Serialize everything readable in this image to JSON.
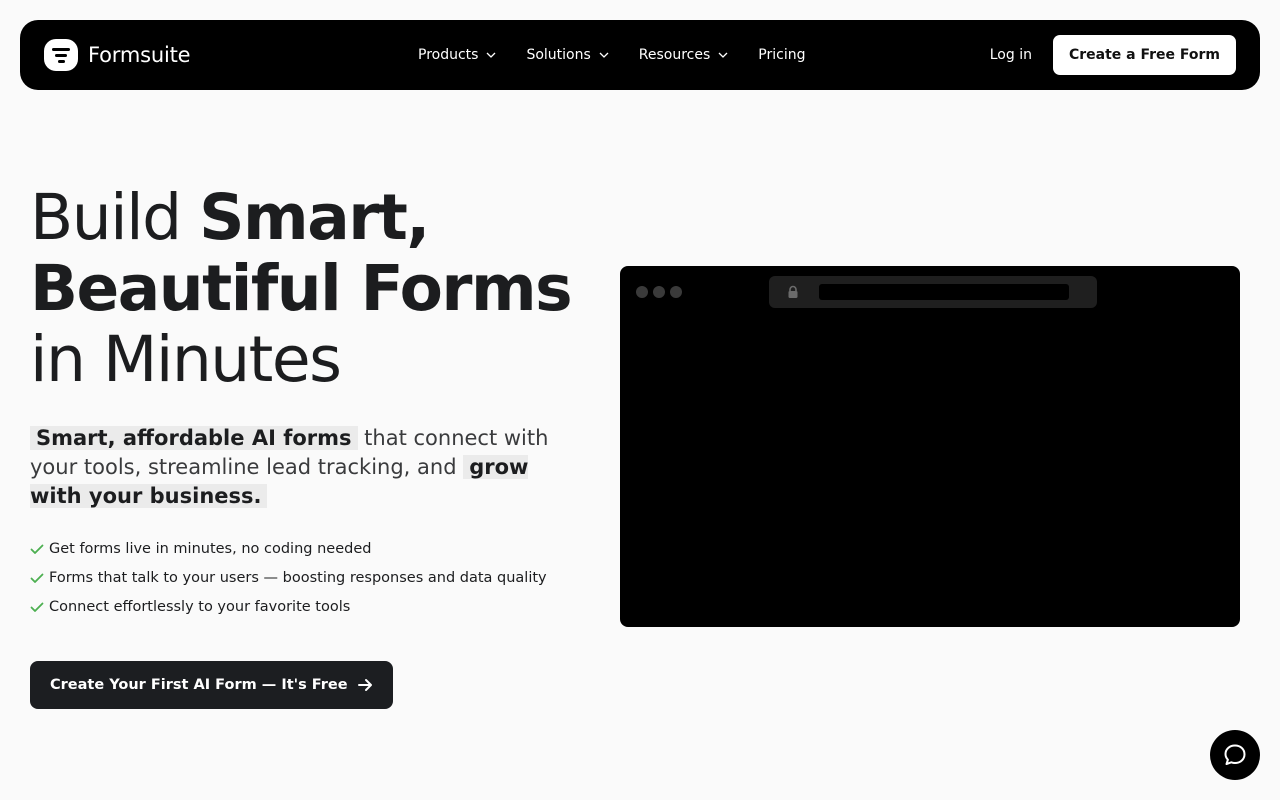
{
  "brand": {
    "name": "Formsuite",
    "logo_icon": "formsuite-logo-icon"
  },
  "nav": {
    "items": [
      {
        "label": "Products",
        "has_dropdown": true
      },
      {
        "label": "Solutions",
        "has_dropdown": true
      },
      {
        "label": "Resources",
        "has_dropdown": true
      },
      {
        "label": "Pricing",
        "has_dropdown": false
      }
    ],
    "login_label": "Log in",
    "cta_label": "Create a Free Form"
  },
  "hero": {
    "headline": {
      "part1": "Build ",
      "part2": "Smart,",
      "part3": "Beautiful Forms",
      "part4": "in Minutes"
    },
    "subheading": {
      "highlight1": "Smart, affordable AI forms",
      "text1": " that connect with your tools, streamline lead tracking, and ",
      "highlight2": "grow with your business."
    },
    "features": [
      "Get forms live in minutes, no coding needed",
      "Forms that talk to your users — boosting responses and data quality",
      "Connect effortlessly to your favorite tools"
    ],
    "cta_label": "Create Your First AI Form — It's Free"
  },
  "colors": {
    "background": "#fafafa",
    "navbar": "#000000",
    "check": "#4caf50",
    "highlight": "#ebebeb",
    "cta_dark": "#1c1e21"
  }
}
